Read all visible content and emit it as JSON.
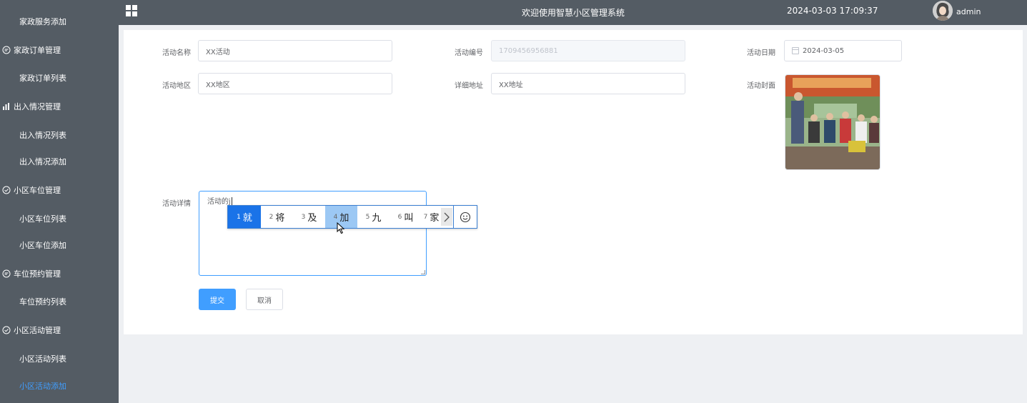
{
  "sidebar": {
    "items": [
      {
        "label": "家政服务添加",
        "type": "sub"
      },
      {
        "label": "家政订单管理",
        "type": "group",
        "icon": "chat-bubble-icon"
      },
      {
        "label": "家政订单列表",
        "type": "sub"
      },
      {
        "label": "出入情况管理",
        "type": "group",
        "icon": "bar-chart-icon"
      },
      {
        "label": "出入情况列表",
        "type": "sub"
      },
      {
        "label": "出入情况添加",
        "type": "sub"
      },
      {
        "label": "小区车位管理",
        "type": "group",
        "icon": "check-circle-icon"
      },
      {
        "label": "小区车位列表",
        "type": "sub"
      },
      {
        "label": "小区车位添加",
        "type": "sub"
      },
      {
        "label": "车位预约管理",
        "type": "group",
        "icon": "chat-bubble-icon"
      },
      {
        "label": "车位预约列表",
        "type": "sub"
      },
      {
        "label": "小区活动管理",
        "type": "group",
        "icon": "check-circle-icon"
      },
      {
        "label": "小区活动列表",
        "type": "sub"
      },
      {
        "label": "小区活动添加",
        "type": "sub",
        "active": true
      }
    ]
  },
  "header": {
    "title": "欢迎使用智慧小区管理系统",
    "datetime": "2024-03-03 17:09:37",
    "username": "admin"
  },
  "form": {
    "name_label": "活动名称",
    "name_value": "XX活动",
    "code_label": "活动编号",
    "code_value": "1709456956881",
    "date_label": "活动日期",
    "date_value": "2024-03-05",
    "region_label": "活动地区",
    "region_value": "XX地区",
    "address_label": "详细地址",
    "address_value": "XX地址",
    "cover_label": "活动封面",
    "detail_label": "活动详情",
    "detail_value": "活动的j",
    "submit_label": "提交",
    "cancel_label": "取消"
  },
  "ime": {
    "candidates": [
      {
        "num": "1",
        "text": "就",
        "state": "selected"
      },
      {
        "num": "2",
        "text": "将",
        "state": ""
      },
      {
        "num": "3",
        "text": "及",
        "state": ""
      },
      {
        "num": "4",
        "text": "加",
        "state": "hover"
      },
      {
        "num": "5",
        "text": "九",
        "state": ""
      },
      {
        "num": "6",
        "text": "叫",
        "state": ""
      },
      {
        "num": "7",
        "text": "家",
        "state": ""
      }
    ]
  },
  "colors": {
    "sidebar_bg": "#545c64",
    "accent": "#409eff",
    "ime_selected": "#1a73e8"
  }
}
